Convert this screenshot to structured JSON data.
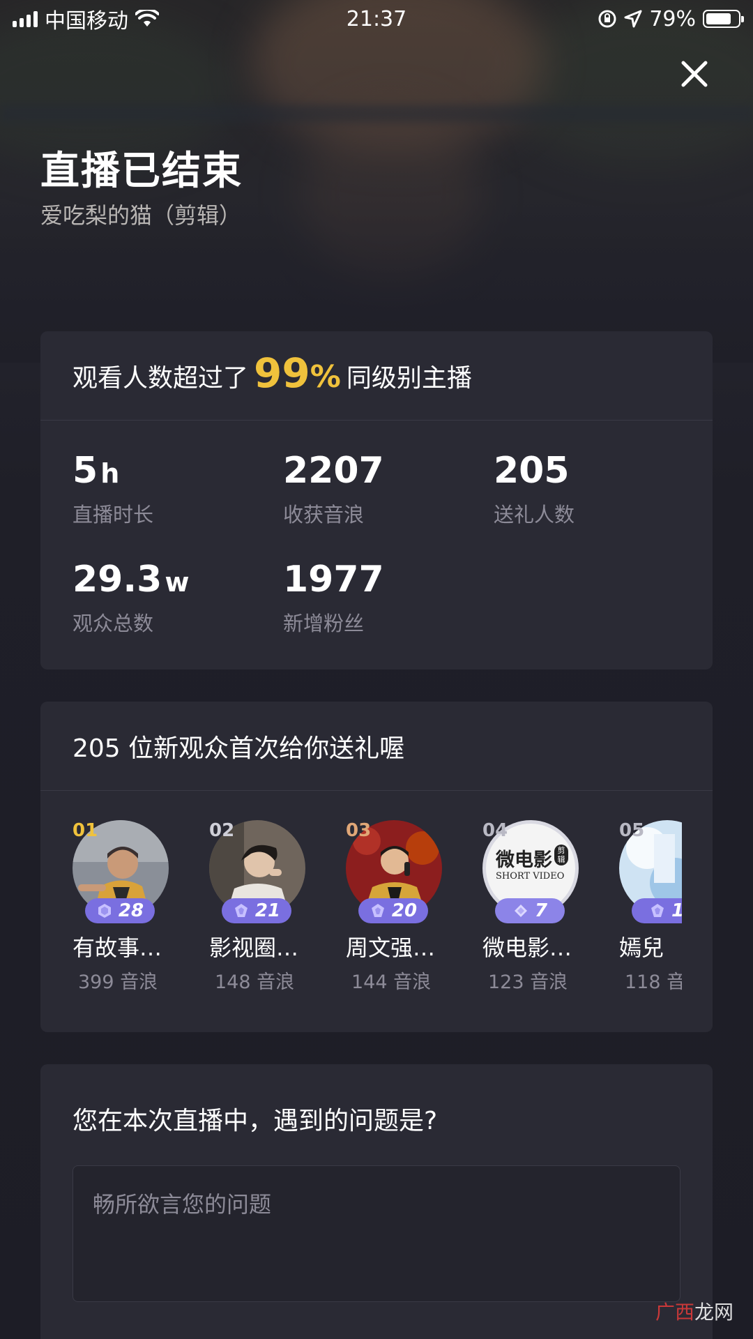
{
  "status_bar": {
    "carrier": "中国移动",
    "time": "21:37",
    "battery_percent": "79%",
    "battery_level": 0.79
  },
  "header": {
    "title": "直播已结束",
    "subtitle": "爱吃梨的猫（剪辑）"
  },
  "summary": {
    "prefix": "观看人数超过了",
    "percent_value": "99",
    "percent_sign": "%",
    "suffix": "同级别主播",
    "accent_color": "#f0c23c",
    "stats": [
      {
        "value": "5",
        "unit": "h",
        "label": "直播时长"
      },
      {
        "value": "2207",
        "unit": "",
        "label": "收获音浪"
      },
      {
        "value": "205",
        "unit": "",
        "label": "送礼人数"
      },
      {
        "value": "29.3",
        "unit": "w",
        "label": "观众总数"
      },
      {
        "value": "1977",
        "unit": "",
        "label": "新增粉丝"
      }
    ]
  },
  "gifters": {
    "heading": "205 位新观众首次给你送礼喔",
    "badge_color": "#7a6fe0",
    "items": [
      {
        "rank": "01",
        "level": "28",
        "name": "有故事…",
        "score": "399 音浪"
      },
      {
        "rank": "02",
        "level": "21",
        "name": "影视圈…",
        "score": "148 音浪"
      },
      {
        "rank": "03",
        "level": "20",
        "name": "周文强…",
        "score": "144 音浪"
      },
      {
        "rank": "04",
        "level": "7",
        "name": "微电影…",
        "score": "123 音浪",
        "avatar_text": "微电影",
        "avatar_sub": "SHORT VIDEO",
        "avatar_tag": "剪辑"
      },
      {
        "rank": "05",
        "level": "1",
        "name": "嫣兒",
        "score": "118 音"
      }
    ]
  },
  "feedback": {
    "question": "您在本次直播中，遇到的问题是?",
    "placeholder": "畅所欲言您的问题"
  },
  "watermark": {
    "text_a": "广西",
    "text_b": "龙网"
  }
}
